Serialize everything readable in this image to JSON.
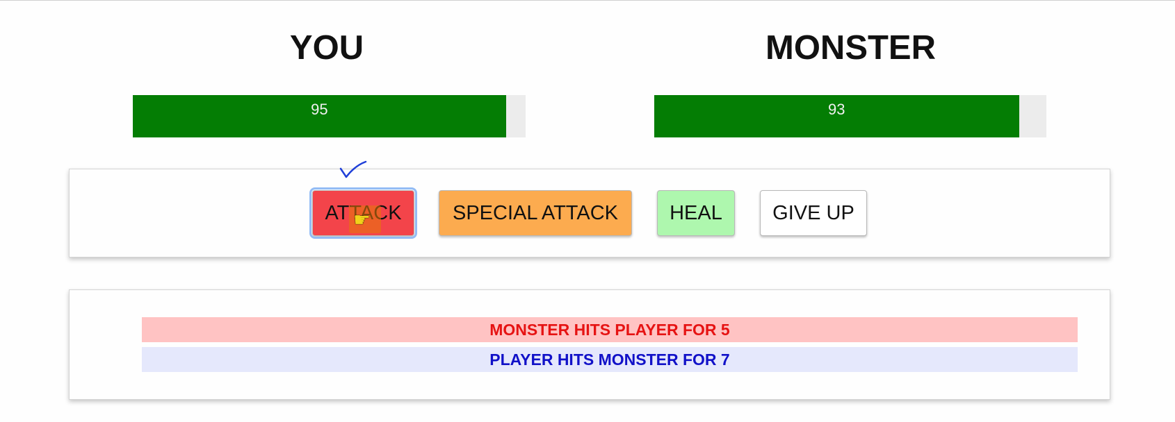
{
  "player": {
    "title": "YOU",
    "health": 95
  },
  "monster": {
    "title": "MONSTER",
    "health": 93
  },
  "controls": {
    "attack_label": "ATTACK",
    "special_attack_label": "SPECIAL ATTACK",
    "heal_label": "HEAL",
    "give_up_label": "GIVE UP"
  },
  "log": {
    "entries": [
      {
        "text": "MONSTER HITS PLAYER FOR 5",
        "actor": "monster"
      },
      {
        "text": "PLAYER HITS MONSTER FOR 7",
        "actor": "player"
      }
    ]
  },
  "colors": {
    "health_bar": "#047d04",
    "attack": "#f3444a",
    "special_attack": "#fcab4f",
    "heal": "#aef7ae",
    "give_up": "#ffffff",
    "monster_log_bg": "#ffc3c3",
    "monster_log_text": "#e61313",
    "player_log_bg": "#e5e8fc",
    "player_log_text": "#1111c8"
  },
  "icons": {
    "cursor": "hand-pointer-icon",
    "annotation": "checkmark-icon"
  }
}
